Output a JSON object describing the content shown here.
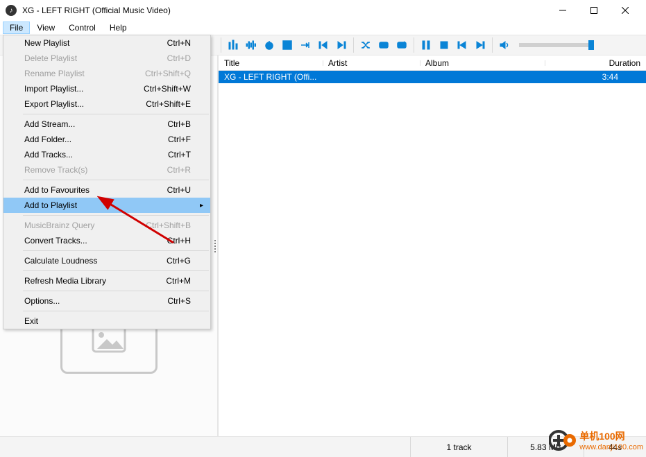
{
  "window": {
    "title": "XG - LEFT RIGHT (Official Music Video)",
    "icon": "disc-icon"
  },
  "menubar": [
    "File",
    "View",
    "Control",
    "Help"
  ],
  "file_menu": {
    "groups": [
      [
        {
          "label": "New Playlist",
          "shortcut": "Ctrl+N",
          "enabled": true
        },
        {
          "label": "Delete Playlist",
          "shortcut": "Ctrl+D",
          "enabled": false
        },
        {
          "label": "Rename Playlist",
          "shortcut": "Ctrl+Shift+Q",
          "enabled": false
        },
        {
          "label": "Import Playlist...",
          "shortcut": "Ctrl+Shift+W",
          "enabled": true
        },
        {
          "label": "Export Playlist...",
          "shortcut": "Ctrl+Shift+E",
          "enabled": true
        }
      ],
      [
        {
          "label": "Add Stream...",
          "shortcut": "Ctrl+B",
          "enabled": true
        },
        {
          "label": "Add Folder...",
          "shortcut": "Ctrl+F",
          "enabled": true
        },
        {
          "label": "Add Tracks...",
          "shortcut": "Ctrl+T",
          "enabled": true
        },
        {
          "label": "Remove Track(s)",
          "shortcut": "Ctrl+R",
          "enabled": false
        }
      ],
      [
        {
          "label": "Add to Favourites",
          "shortcut": "Ctrl+U",
          "enabled": true
        },
        {
          "label": "Add to Playlist",
          "shortcut": "",
          "enabled": true,
          "submenu": true,
          "highlight": true
        }
      ],
      [
        {
          "label": "MusicBrainz Query",
          "shortcut": "Ctrl+Shift+B",
          "enabled": false
        },
        {
          "label": "Convert Tracks...",
          "shortcut": "Ctrl+H",
          "enabled": true
        }
      ],
      [
        {
          "label": "Calculate Loudness",
          "shortcut": "Ctrl+G",
          "enabled": true
        }
      ],
      [
        {
          "label": "Refresh Media Library",
          "shortcut": "Ctrl+M",
          "enabled": true
        }
      ],
      [
        {
          "label": "Options...",
          "shortcut": "Ctrl+S",
          "enabled": true
        }
      ],
      [
        {
          "label": "Exit",
          "shortcut": "",
          "enabled": true
        }
      ]
    ]
  },
  "toolbar_icons": [
    "equalizer",
    "waveform",
    "timer",
    "import",
    "goto",
    "skip-back-track",
    "skip-fwd-track",
    "shuffle",
    "repeat-one",
    "repeat-all",
    "pause",
    "stop",
    "prev",
    "next",
    "volume"
  ],
  "playlist": {
    "columns": {
      "title": "Title",
      "artist": "Artist",
      "album": "Album",
      "duration": "Duration"
    },
    "rows": [
      {
        "title": "XG - LEFT RIGHT (Offi...",
        "artist": "",
        "album": "",
        "duration": "3:44"
      }
    ]
  },
  "statusbar": {
    "tracks": "1 track",
    "size": "5.83 MB",
    "seconds": "44s"
  },
  "watermark": {
    "line1": "单机100网",
    "line2": "www.danji100.com"
  }
}
